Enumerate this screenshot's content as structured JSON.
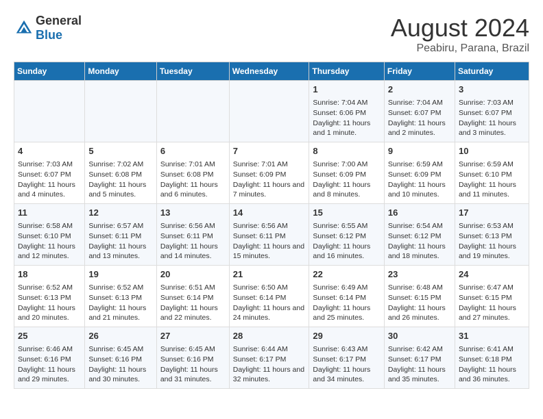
{
  "logo": {
    "text_general": "General",
    "text_blue": "Blue"
  },
  "title": "August 2024",
  "subtitle": "Peabiru, Parana, Brazil",
  "days_of_week": [
    "Sunday",
    "Monday",
    "Tuesday",
    "Wednesday",
    "Thursday",
    "Friday",
    "Saturday"
  ],
  "weeks": [
    [
      {
        "day": "",
        "info": ""
      },
      {
        "day": "",
        "info": ""
      },
      {
        "day": "",
        "info": ""
      },
      {
        "day": "",
        "info": ""
      },
      {
        "day": "1",
        "info": "Sunrise: 7:04 AM\nSunset: 6:06 PM\nDaylight: 11 hours and 1 minute."
      },
      {
        "day": "2",
        "info": "Sunrise: 7:04 AM\nSunset: 6:07 PM\nDaylight: 11 hours and 2 minutes."
      },
      {
        "day": "3",
        "info": "Sunrise: 7:03 AM\nSunset: 6:07 PM\nDaylight: 11 hours and 3 minutes."
      }
    ],
    [
      {
        "day": "4",
        "info": "Sunrise: 7:03 AM\nSunset: 6:07 PM\nDaylight: 11 hours and 4 minutes."
      },
      {
        "day": "5",
        "info": "Sunrise: 7:02 AM\nSunset: 6:08 PM\nDaylight: 11 hours and 5 minutes."
      },
      {
        "day": "6",
        "info": "Sunrise: 7:01 AM\nSunset: 6:08 PM\nDaylight: 11 hours and 6 minutes."
      },
      {
        "day": "7",
        "info": "Sunrise: 7:01 AM\nSunset: 6:09 PM\nDaylight: 11 hours and 7 minutes."
      },
      {
        "day": "8",
        "info": "Sunrise: 7:00 AM\nSunset: 6:09 PM\nDaylight: 11 hours and 8 minutes."
      },
      {
        "day": "9",
        "info": "Sunrise: 6:59 AM\nSunset: 6:09 PM\nDaylight: 11 hours and 10 minutes."
      },
      {
        "day": "10",
        "info": "Sunrise: 6:59 AM\nSunset: 6:10 PM\nDaylight: 11 hours and 11 minutes."
      }
    ],
    [
      {
        "day": "11",
        "info": "Sunrise: 6:58 AM\nSunset: 6:10 PM\nDaylight: 11 hours and 12 minutes."
      },
      {
        "day": "12",
        "info": "Sunrise: 6:57 AM\nSunset: 6:11 PM\nDaylight: 11 hours and 13 minutes."
      },
      {
        "day": "13",
        "info": "Sunrise: 6:56 AM\nSunset: 6:11 PM\nDaylight: 11 hours and 14 minutes."
      },
      {
        "day": "14",
        "info": "Sunrise: 6:56 AM\nSunset: 6:11 PM\nDaylight: 11 hours and 15 minutes."
      },
      {
        "day": "15",
        "info": "Sunrise: 6:55 AM\nSunset: 6:12 PM\nDaylight: 11 hours and 16 minutes."
      },
      {
        "day": "16",
        "info": "Sunrise: 6:54 AM\nSunset: 6:12 PM\nDaylight: 11 hours and 18 minutes."
      },
      {
        "day": "17",
        "info": "Sunrise: 6:53 AM\nSunset: 6:13 PM\nDaylight: 11 hours and 19 minutes."
      }
    ],
    [
      {
        "day": "18",
        "info": "Sunrise: 6:52 AM\nSunset: 6:13 PM\nDaylight: 11 hours and 20 minutes."
      },
      {
        "day": "19",
        "info": "Sunrise: 6:52 AM\nSunset: 6:13 PM\nDaylight: 11 hours and 21 minutes."
      },
      {
        "day": "20",
        "info": "Sunrise: 6:51 AM\nSunset: 6:14 PM\nDaylight: 11 hours and 22 minutes."
      },
      {
        "day": "21",
        "info": "Sunrise: 6:50 AM\nSunset: 6:14 PM\nDaylight: 11 hours and 24 minutes."
      },
      {
        "day": "22",
        "info": "Sunrise: 6:49 AM\nSunset: 6:14 PM\nDaylight: 11 hours and 25 minutes."
      },
      {
        "day": "23",
        "info": "Sunrise: 6:48 AM\nSunset: 6:15 PM\nDaylight: 11 hours and 26 minutes."
      },
      {
        "day": "24",
        "info": "Sunrise: 6:47 AM\nSunset: 6:15 PM\nDaylight: 11 hours and 27 minutes."
      }
    ],
    [
      {
        "day": "25",
        "info": "Sunrise: 6:46 AM\nSunset: 6:16 PM\nDaylight: 11 hours and 29 minutes."
      },
      {
        "day": "26",
        "info": "Sunrise: 6:45 AM\nSunset: 6:16 PM\nDaylight: 11 hours and 30 minutes."
      },
      {
        "day": "27",
        "info": "Sunrise: 6:45 AM\nSunset: 6:16 PM\nDaylight: 11 hours and 31 minutes."
      },
      {
        "day": "28",
        "info": "Sunrise: 6:44 AM\nSunset: 6:17 PM\nDaylight: 11 hours and 32 minutes."
      },
      {
        "day": "29",
        "info": "Sunrise: 6:43 AM\nSunset: 6:17 PM\nDaylight: 11 hours and 34 minutes."
      },
      {
        "day": "30",
        "info": "Sunrise: 6:42 AM\nSunset: 6:17 PM\nDaylight: 11 hours and 35 minutes."
      },
      {
        "day": "31",
        "info": "Sunrise: 6:41 AM\nSunset: 6:18 PM\nDaylight: 11 hours and 36 minutes."
      }
    ]
  ]
}
